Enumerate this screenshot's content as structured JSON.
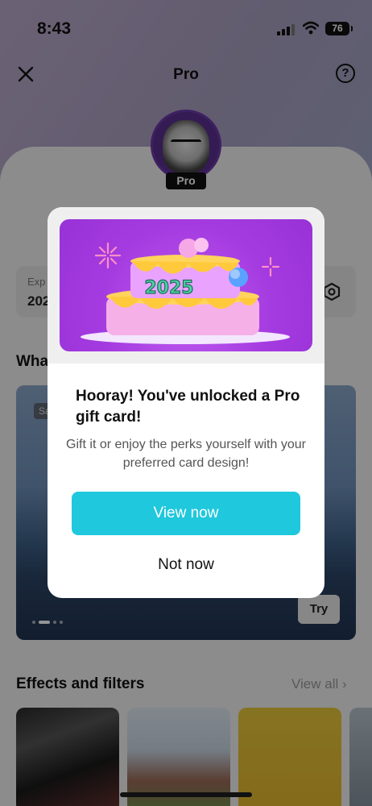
{
  "status_bar": {
    "time": "8:43",
    "battery": "76"
  },
  "nav": {
    "title": "Pro"
  },
  "profile": {
    "badge": "Pro"
  },
  "subscription": {
    "label": "Exp",
    "value": "202"
  },
  "sections": {
    "whats_new_partial": "Wha",
    "effects_title": "Effects and filters",
    "view_all": "View all"
  },
  "banner": {
    "tag": "Sa",
    "try_label": "Try"
  },
  "modal": {
    "title": "Hooray! You've unlocked a Pro gift card!",
    "body": "Gift it or enjoy the perks yourself with your preferred card design!",
    "primary_label": "View now",
    "secondary_label": "Not now",
    "cake_year": "2025"
  },
  "colors": {
    "accent": "#1fc8dc",
    "hero_purple": "#a43be0"
  }
}
